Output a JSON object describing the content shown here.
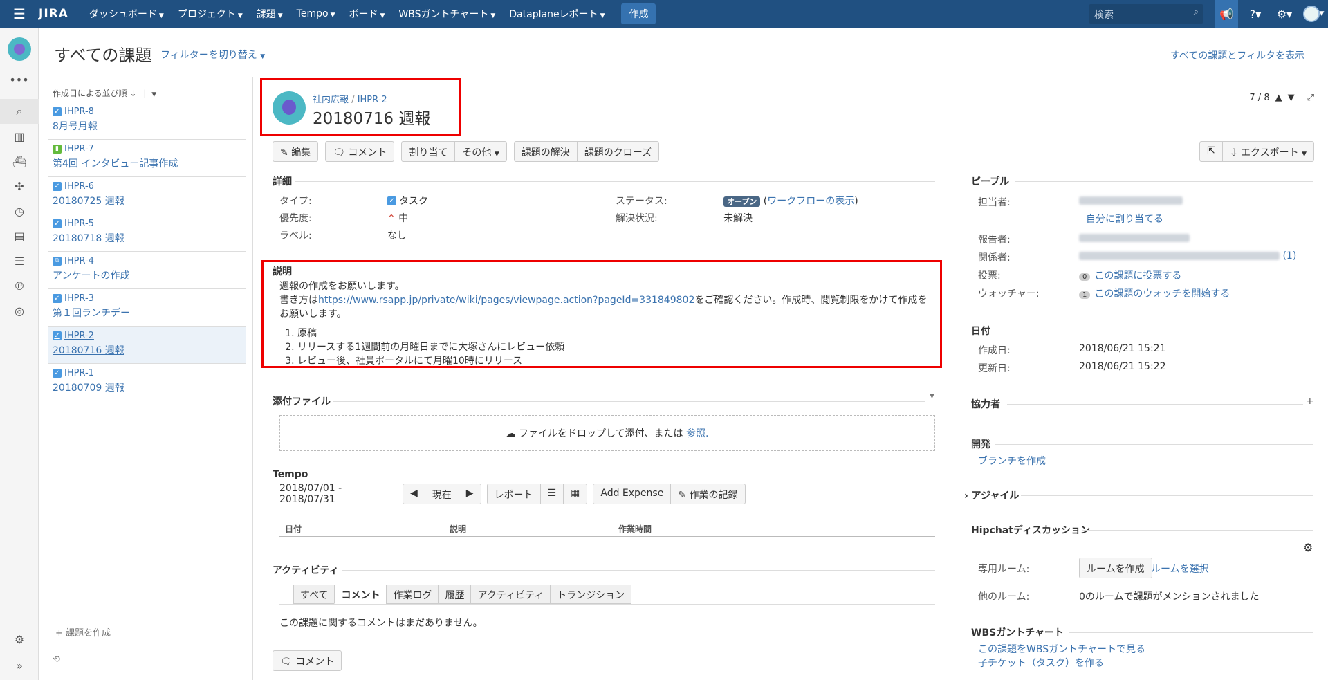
{
  "topbar": {
    "logo": "JIRA",
    "nav": [
      "ダッシュボード",
      "プロジェクト",
      "課題",
      "Tempo",
      "ボード",
      "WBSガントチャート",
      "Dataplaneレポート"
    ],
    "create_label": "作成",
    "search_placeholder": "検索",
    "colors": {
      "bar": "#205081",
      "active": "#3572b0"
    }
  },
  "header": {
    "title": "すべての課題",
    "filter_switch": "フィルターを切り替え",
    "show_all": "すべての課題とフィルタを表示"
  },
  "list": {
    "sort_label": "作成日による並び順",
    "items": [
      {
        "key": "IHPR-8",
        "summary": "8月号月報",
        "type": "task-icon"
      },
      {
        "key": "IHPR-7",
        "summary": "第4回 インタビュー記事作成",
        "type": "story-icon"
      },
      {
        "key": "IHPR-6",
        "summary": "20180725 週報",
        "type": "task-icon"
      },
      {
        "key": "IHPR-5",
        "summary": "20180718 週報",
        "type": "task-icon"
      },
      {
        "key": "IHPR-4",
        "summary": "アンケートの作成",
        "type": "subtask-icon"
      },
      {
        "key": "IHPR-3",
        "summary": "第１回ランチデー",
        "type": "task-icon"
      },
      {
        "key": "IHPR-2",
        "summary": "20180716 週報",
        "type": "task-icon"
      },
      {
        "key": "IHPR-1",
        "summary": "20180709 週報",
        "type": "task-icon"
      }
    ],
    "create_issue": "+ 課題を作成"
  },
  "issue": {
    "project": "社内広報",
    "key": "IHPR-2",
    "title": "20180716 週報",
    "pager": "7 / 8",
    "toolbar": {
      "edit": "編集",
      "comment": "コメント",
      "assign": "割り当て",
      "more": "その他",
      "resolve": "課題の解決",
      "close": "課題のクローズ",
      "export": "エクスポート"
    },
    "details": {
      "heading": "詳細",
      "type_label": "タイプ:",
      "type_value": "タスク",
      "priority_label": "優先度:",
      "priority_value": "中",
      "labels_label": "ラベル:",
      "labels_value": "なし",
      "status_label": "ステータス:",
      "status_value": "オープン",
      "workflow_link": "ワークフローの表示",
      "resolution_label": "解決状況:",
      "resolution_value": "未解決"
    },
    "description": {
      "heading": "説明",
      "line1": "週報の作成をお願いします。",
      "line2_prefix": "書き方は",
      "line2_link": "https://www.rsapp.jp/private/wiki/pages/viewpage.action?pageId=331849802",
      "line2_suffix": "をご確認ください。作成時、閲覧制限をかけて作成をお願いします。",
      "steps": [
        "原稿",
        "リリースする1週間前の月曜日までに大塚さんにレビュー依頼",
        "レビュー後、社員ポータルにて月曜10時にリリース"
      ]
    },
    "attachments": {
      "heading": "添付ファイル",
      "drop_text": "ファイルをドロップして添付、または",
      "browse": "参照."
    },
    "tempo": {
      "heading": "Tempo",
      "range": "2018/07/01 - 2018/07/31",
      "now": "現在",
      "report": "レポート",
      "add_expense": "Add Expense",
      "log_work": "作業の記録",
      "col_date": "日付",
      "col_desc": "説明",
      "col_time": "作業時間"
    },
    "activity": {
      "heading": "アクティビティ",
      "tabs": [
        "すべて",
        "コメント",
        "作業ログ",
        "履歴",
        "アクティビティ",
        "トランジション"
      ],
      "empty": "この課題に関するコメントはまだありません。",
      "comment_btn": "コメント"
    }
  },
  "people": {
    "heading": "ピープル",
    "assignee_label": "担当者:",
    "assign_me": "自分に割り当てる",
    "reporter_label": "報告者:",
    "related_label": "関係者:",
    "related_more": "(1)",
    "votes_label": "投票:",
    "votes_count": "0",
    "vote_link": "この課題に投票する",
    "watchers_label": "ウォッチャー:",
    "watchers_count": "1",
    "watch_link": "この課題のウォッチを開始する"
  },
  "dates": {
    "heading": "日付",
    "created_label": "作成日:",
    "created": "2018/06/21 15:21",
    "updated_label": "更新日:",
    "updated": "2018/06/21 15:22"
  },
  "collab": {
    "heading": "協力者"
  },
  "dev": {
    "heading": "開発",
    "branch": "ブランチを作成"
  },
  "agile": {
    "heading": "アジャイル"
  },
  "hipchat": {
    "heading": "Hipchatディスカッション",
    "room_label": "専用ルーム:",
    "create_room": "ルームを作成",
    "select_room": "ルームを選択",
    "other_label": "他のルーム:",
    "other_value": "0のルームで課題がメンションされました"
  },
  "wbs": {
    "heading": "WBSガントチャート",
    "view": "この課題をWBSガントチャートで見る",
    "child": "子チケット（タスク）を作る"
  }
}
